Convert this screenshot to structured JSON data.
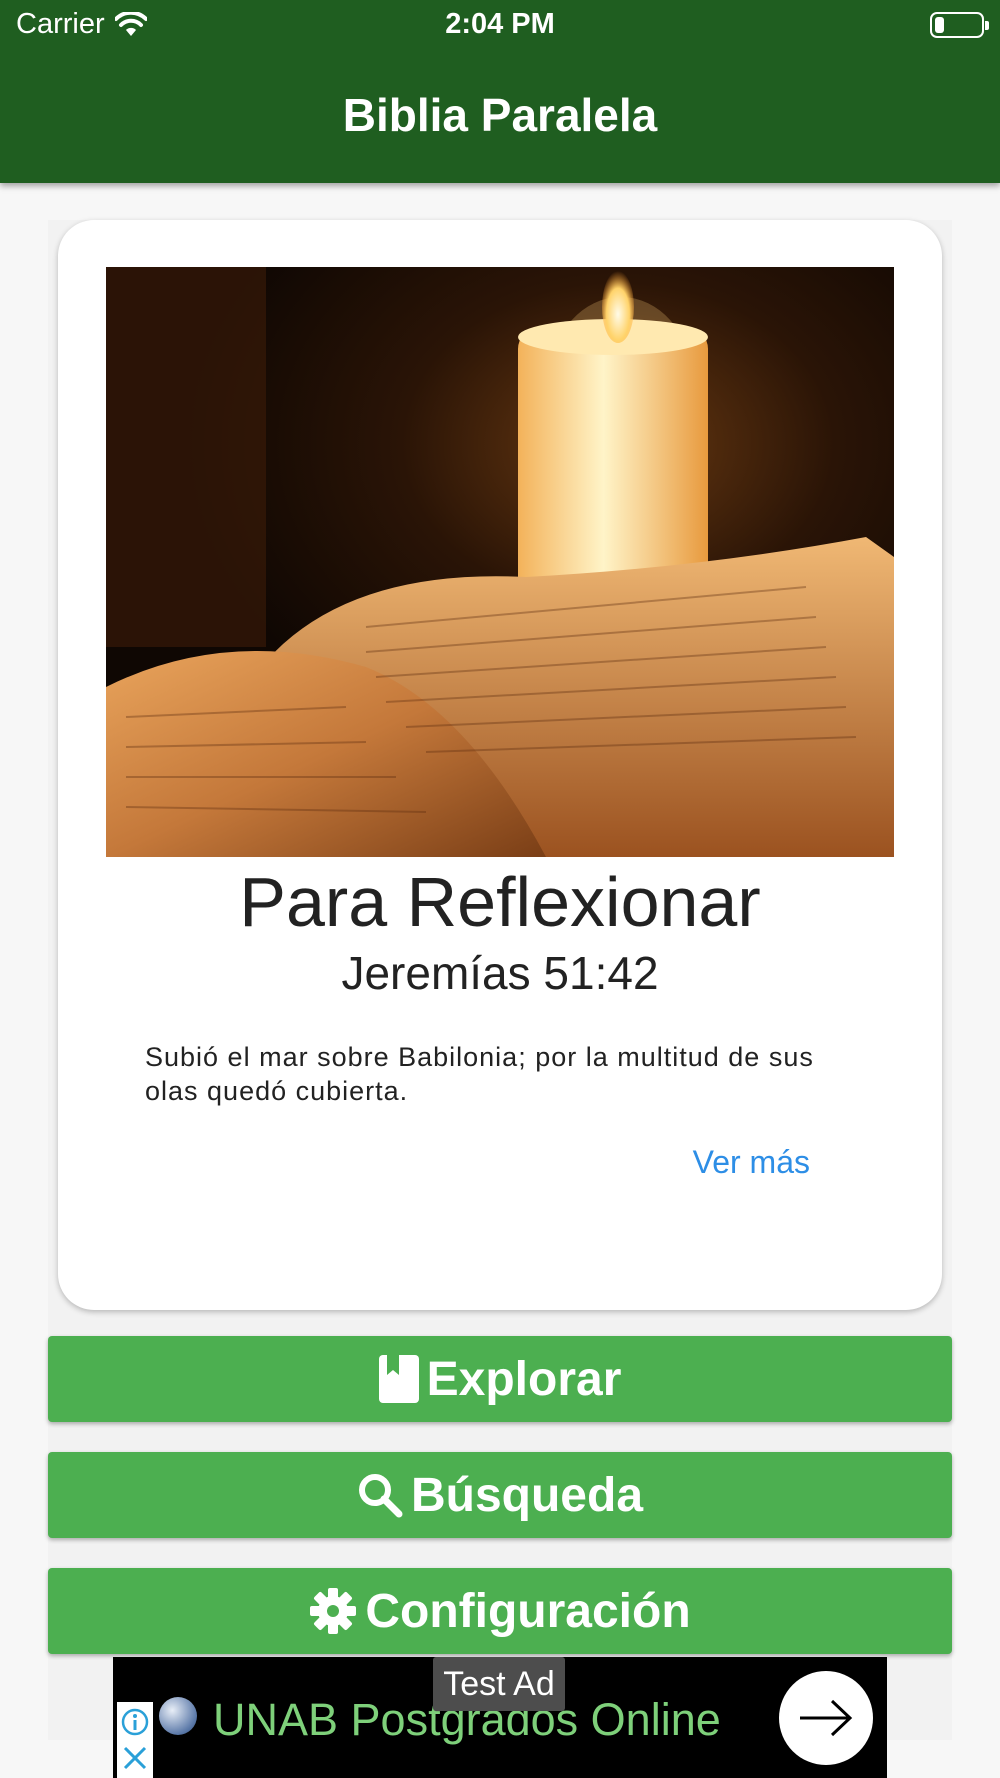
{
  "status_bar": {
    "carrier": "Carrier",
    "time": "2:04 PM",
    "battery_level": 0.2
  },
  "nav": {
    "title": "Biblia Paralela"
  },
  "card": {
    "image_alt": "Open Bible with a lit candle",
    "title": "Para Reflexionar",
    "reference": "Jeremías 51:42",
    "verse": "Subió el mar sobre Babilonia; por la multitud de sus olas quedó cubierta.",
    "more_label": "Ver más"
  },
  "buttons": [
    {
      "label": "Explorar",
      "icon": "bookmark-icon"
    },
    {
      "label": "Búsqueda",
      "icon": "search-icon"
    },
    {
      "label": "Configuración",
      "icon": "gear-icon"
    }
  ],
  "ad": {
    "tag": "Test Ad",
    "text": "UNAB Postgrados Online"
  },
  "colors": {
    "nav_bar": "#1f5e20",
    "button": "#4caf50",
    "link": "#2d8ee6"
  }
}
